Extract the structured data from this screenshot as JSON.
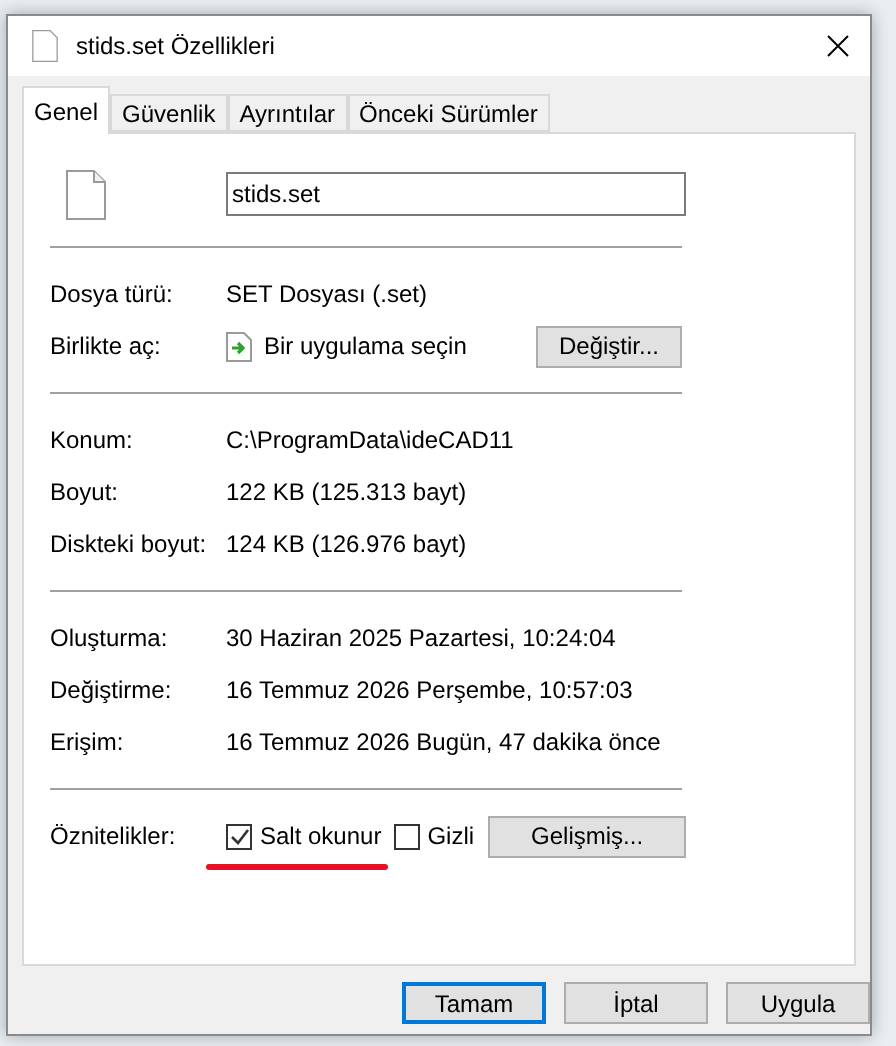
{
  "window": {
    "title": "stids.set Özellikleri"
  },
  "tabs": [
    {
      "label": "Genel",
      "selected": true
    },
    {
      "label": "Güvenlik",
      "selected": false
    },
    {
      "label": "Ayrıntılar",
      "selected": false
    },
    {
      "label": "Önceki Sürümler",
      "selected": false
    }
  ],
  "file_name": {
    "value": "stids.set"
  },
  "sections": [
    [
      {
        "label": "Dosya türü:",
        "value": "SET Dosyası (.set)",
        "kind": "text"
      },
      {
        "label": "Birlikte aç:",
        "value": "Bir uygulama seçin",
        "kind": "app",
        "button": "Değiştir..."
      }
    ],
    [
      {
        "label": "Konum:",
        "value": "C:\\ProgramData\\ideCAD11",
        "kind": "text"
      },
      {
        "label": "Boyut:",
        "value": "122 KB (125.313 bayt)",
        "kind": "text"
      },
      {
        "label": "Diskteki boyut:",
        "value": "124 KB (126.976 bayt)",
        "kind": "text"
      }
    ],
    [
      {
        "label": "Oluşturma:",
        "value": "30 Haziran 2025 Pazartesi, 10:24:04",
        "kind": "text"
      },
      {
        "label": "Değiştirme:",
        "value": "16 Temmuz 2026 Perşembe, 10:57:03",
        "kind": "text"
      },
      {
        "label": "Erişim:",
        "value": "16 Temmuz 2026 Bugün, 47 dakika önce",
        "kind": "text"
      }
    ]
  ],
  "attributes": {
    "label": "Öznitelikler:",
    "checkboxes": [
      {
        "label": "Salt okunur",
        "checked": true,
        "underlined": true
      },
      {
        "label": "Gizli",
        "checked": false,
        "underlined": false
      }
    ],
    "button": "Gelişmiş..."
  },
  "buttons": [
    {
      "label": "Tamam",
      "default": true
    },
    {
      "label": "İptal",
      "default": false
    },
    {
      "label": "Uygula",
      "default": false
    }
  ]
}
